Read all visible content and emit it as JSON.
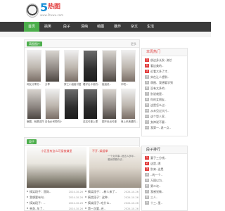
{
  "header": {
    "logo_number": "5",
    "logo_text": "热图",
    "logo_url": "www.5tuwu.com"
  },
  "nav": {
    "items": [
      "首页",
      "搞笑",
      "段子",
      "清纯",
      "萌图",
      "暴炸",
      "杂文",
      "生活"
    ],
    "active_index": 0
  },
  "colors": {
    "accent": "#4cae4c",
    "nav_bg": "#3a3a3a",
    "hot": "#e24040"
  },
  "gallery": {
    "title": "萌图图片",
    "more": "更多",
    "captions_row1": [
      "网友分享的..",
      "分享",
      "穿工小姐姐可爱了",
      "看好出卡前的..",
      "姐姐说..",
      "口吧..."
    ],
    "captions_row2": [
      "骗图、就是这样",
      "白色纱吊带的小姐姐",
      "",
      "这这可爱上课",
      "图不卖出可爱",
      "肩上系美腿的..."
    ]
  },
  "hot": {
    "title": "本周热门",
    "items": [
      "俊这身长发..流芯",
      "看这美的..",
      "近看大多了才..",
      "实在让人想到..",
      "萌图、我想要学到",
      "没有太多的..",
      "别说就是..",
      "你的女朋友..",
      "这是怎么过..",
      "从未见过大片..",
      "这个型人家..",
      "女神说不要..",
      "我第一..说一点.."
    ]
  },
  "jokes": {
    "title": "段子",
    "feature1_caption": "小区里有这么可爱被嫌里",
    "feature2_caption": "不开..娱姐拳",
    "feature2_text": "一个女同事..她这么多年.. 看我帮着你去..",
    "rows_left": [
      {
        "text": "搞笑段子：国际..",
        "date": "2024-10-26"
      },
      {
        "text": "我想要有句..",
        "date": "2024-10-26"
      },
      {
        "text": "搞笑段子：..",
        "date": "2024-10-26"
      },
      {
        "text": "单身..年了..",
        "date": "2024-10-26"
      },
      {
        "text": "小学同班同学..",
        "date": "2024-10-26"
      }
    ],
    "rows_mid": [
      {
        "text": "搞笑段子：..新人来了..",
        "date": "2024-10-26"
      },
      {
        "text": "搞笑段子：这种..",
        "date": "2024-10-26"
      },
      {
        "text": "搞笑段子..吃什么..",
        "date": "2024-10-26"
      },
      {
        "text": "第一次要..还..",
        "date": "2024-10-26"
      }
    ]
  },
  "ranking": {
    "title": "段子排行",
    "items": [
      "妻子三分钱..",
      "这是..嗯",
      "别来..这是",
      "..的一个..",
      "万国以为..",
      "第二次..",
      "我感觉做..",
      "三人..",
      "十三..里.."
    ]
  }
}
